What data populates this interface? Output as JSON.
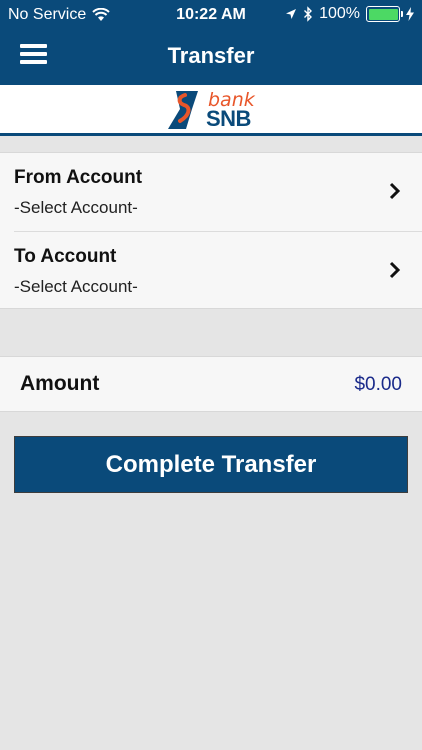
{
  "status_bar": {
    "carrier": "No Service",
    "time": "10:22 AM",
    "battery": "100%",
    "battery_level": 1.0,
    "icons": [
      "wifi-icon",
      "location-arrow-icon",
      "bluetooth-icon",
      "battery-icon",
      "charging-icon"
    ]
  },
  "nav": {
    "title": "Transfer",
    "menu_icon": "hamburger-menu-icon"
  },
  "logo": {
    "bank": "bank",
    "name": "SNB",
    "colors": {
      "blue": "#0a4a7a",
      "orange": "#e8562a"
    }
  },
  "from_account": {
    "label": "From Account",
    "value": "-Select Account-"
  },
  "to_account": {
    "label": "To Account",
    "value": "-Select Account-"
  },
  "amount": {
    "label": "Amount",
    "value": "$0.00"
  },
  "actions": {
    "complete_label": "Complete Transfer"
  },
  "theme": {
    "primary": "#0a4a7a",
    "background": "#e5e5e5",
    "amount_color": "#1a2a8a"
  }
}
